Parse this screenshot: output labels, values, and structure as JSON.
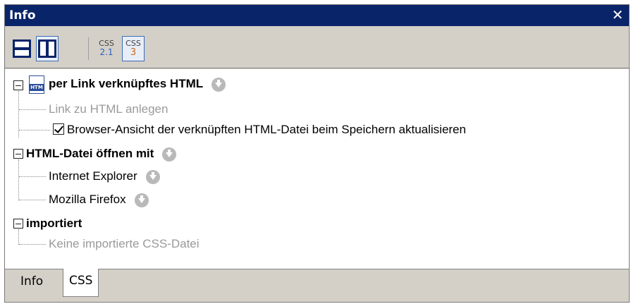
{
  "window": {
    "title": "Info",
    "close_glyph": "✕"
  },
  "toolbar": {
    "buttons": [
      {
        "icon": "horizontal-layout-icon",
        "pressed": false
      },
      {
        "icon": "vertical-layout-icon",
        "pressed": true
      },
      {
        "icon": "css21-icon",
        "label_top": "CSS",
        "label_bottom": "2.1",
        "pressed": false
      },
      {
        "icon": "css3-icon",
        "label_top": "CSS",
        "label_bottom": "3",
        "pressed": true
      }
    ]
  },
  "tree": {
    "section1": {
      "title": "per Link verknüpftes HTML",
      "file_icon_label": "HTM",
      "items": [
        {
          "label": "Link zu HTML anlegen"
        },
        {
          "label": "Browser-Ansicht der verknüpften HTML-Datei beim Speichern aktualisieren",
          "checked": true
        }
      ]
    },
    "section2": {
      "title": "HTML-Datei öffnen mit",
      "items": [
        {
          "label": "Internet Explorer"
        },
        {
          "label": "Mozilla Firefox"
        }
      ]
    },
    "section3": {
      "title": "importiert",
      "items": [
        {
          "label": "Keine importierte CSS-Datei"
        }
      ]
    }
  },
  "tabs": [
    {
      "label": "Info",
      "active": false
    },
    {
      "label": "CSS",
      "active": true
    }
  ],
  "colors": {
    "titlebar": "#0a246a",
    "chrome": "#d4d0c8",
    "css21_accent": "#2a5fc4",
    "css3_accent": "#d0661a",
    "disabled_text": "#9a9a9a"
  }
}
